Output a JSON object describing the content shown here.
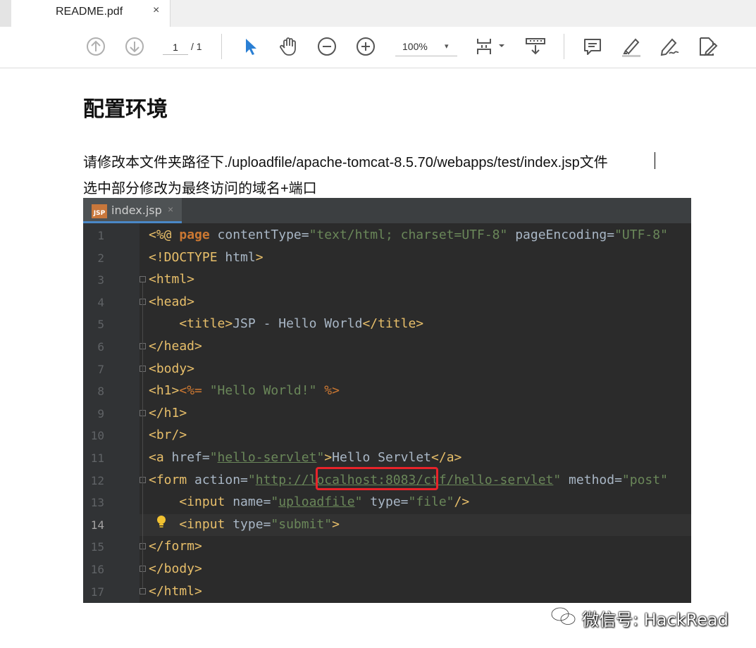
{
  "tab": {
    "title": "README.pdf",
    "close": "×"
  },
  "toolbar": {
    "page_current": "1",
    "page_total": "/ 1",
    "zoom": "100%",
    "zoom_caret": "▾"
  },
  "document": {
    "heading": "配置环境",
    "instruction_line1": "请修改本文件夹路径下./uploadfile/apache-tomcat-8.5.70/webapps/test/index.jsp文件",
    "instruction_line2": "选中部分修改为最终访问的域名+端口"
  },
  "code_editor": {
    "tab_label": "index.jsp",
    "tab_icon_text": "JSP",
    "tab_close": "×",
    "line_numbers": [
      "1",
      "2",
      "3",
      "4",
      "5",
      "6",
      "7",
      "8",
      "9",
      "10",
      "11",
      "12",
      "13",
      "14",
      "15",
      "16",
      "17"
    ],
    "current_line": "14",
    "lines": {
      "l1": [
        {
          "t": "<%@ ",
          "c": "t"
        },
        {
          "t": "page ",
          "c": "k"
        },
        {
          "t": "contentType=",
          "c": ""
        },
        {
          "t": "\"text/html; charset=UTF-8\"",
          "c": "s"
        },
        {
          "t": " pageEncoding=",
          "c": ""
        },
        {
          "t": "\"UTF-8\"",
          "c": "s"
        }
      ],
      "l2": [
        {
          "t": "<!DOCTYPE ",
          "c": "t"
        },
        {
          "t": "html",
          "c": ""
        },
        {
          "t": ">",
          "c": "t"
        }
      ],
      "l3": [
        {
          "t": "<html>",
          "c": "t"
        }
      ],
      "l4": [
        {
          "t": "<head>",
          "c": "t"
        }
      ],
      "l5": [
        {
          "t": "    <title>",
          "c": "t"
        },
        {
          "t": "JSP - Hello World",
          "c": ""
        },
        {
          "t": "</title>",
          "c": "t"
        }
      ],
      "l6": [
        {
          "t": "</head>",
          "c": "t"
        }
      ],
      "l7": [
        {
          "t": "<body>",
          "c": "t"
        }
      ],
      "l8": [
        {
          "t": "<h1>",
          "c": "t"
        },
        {
          "t": "<%= ",
          "c": "e"
        },
        {
          "t": "\"Hello World!\" ",
          "c": "s"
        },
        {
          "t": "%>",
          "c": "e"
        }
      ],
      "l9": [
        {
          "t": "</h1>",
          "c": "t"
        }
      ],
      "l10": [
        {
          "t": "<br/>",
          "c": "t"
        }
      ],
      "l11": [
        {
          "t": "<a ",
          "c": "t"
        },
        {
          "t": "href=",
          "c": ""
        },
        {
          "t": "\"",
          "c": "s"
        },
        {
          "t": "hello-servlet",
          "c": "u"
        },
        {
          "t": "\"",
          "c": "s"
        },
        {
          "t": ">",
          "c": "t"
        },
        {
          "t": "Hello Servlet",
          "c": ""
        },
        {
          "t": "</a>",
          "c": "t"
        }
      ],
      "l12": [
        {
          "t": "<form ",
          "c": "t"
        },
        {
          "t": "action=",
          "c": ""
        },
        {
          "t": "\"",
          "c": "s"
        },
        {
          "t": "http://localhost:8083/ctf/hello-servlet",
          "c": "u"
        },
        {
          "t": "\"",
          "c": "s"
        },
        {
          "t": " method=",
          "c": ""
        },
        {
          "t": "\"post\"",
          "c": "s"
        }
      ],
      "l13": [
        {
          "t": "    <input ",
          "c": "t"
        },
        {
          "t": "name=",
          "c": ""
        },
        {
          "t": "\"",
          "c": "s"
        },
        {
          "t": "uploadfile",
          "c": "u"
        },
        {
          "t": "\"",
          "c": "s"
        },
        {
          "t": " type=",
          "c": ""
        },
        {
          "t": "\"file\"",
          "c": "s"
        },
        {
          "t": "/>",
          "c": "t"
        }
      ],
      "l14": [
        {
          "t": "    <input ",
          "c": "t"
        },
        {
          "t": "type=",
          "c": ""
        },
        {
          "t": "\"submit\"",
          "c": "s"
        },
        {
          "t": ">",
          "c": "t"
        }
      ],
      "l15": [
        {
          "t": "</form>",
          "c": "t"
        }
      ],
      "l16": [
        {
          "t": "</body>",
          "c": "t"
        }
      ],
      "l17": [
        {
          "t": "</html>",
          "c": "t"
        }
      ]
    }
  },
  "watermark": {
    "text": "微信号: HackRead"
  },
  "colors": {
    "editor_bg": "#2b2b2b",
    "tag": "#e8bf6a",
    "keyword": "#cc7832",
    "string": "#6a8759",
    "highlight_box": "#e8232a",
    "toolbar_icon": "#555555",
    "select_tool": "#2a7fd4"
  }
}
